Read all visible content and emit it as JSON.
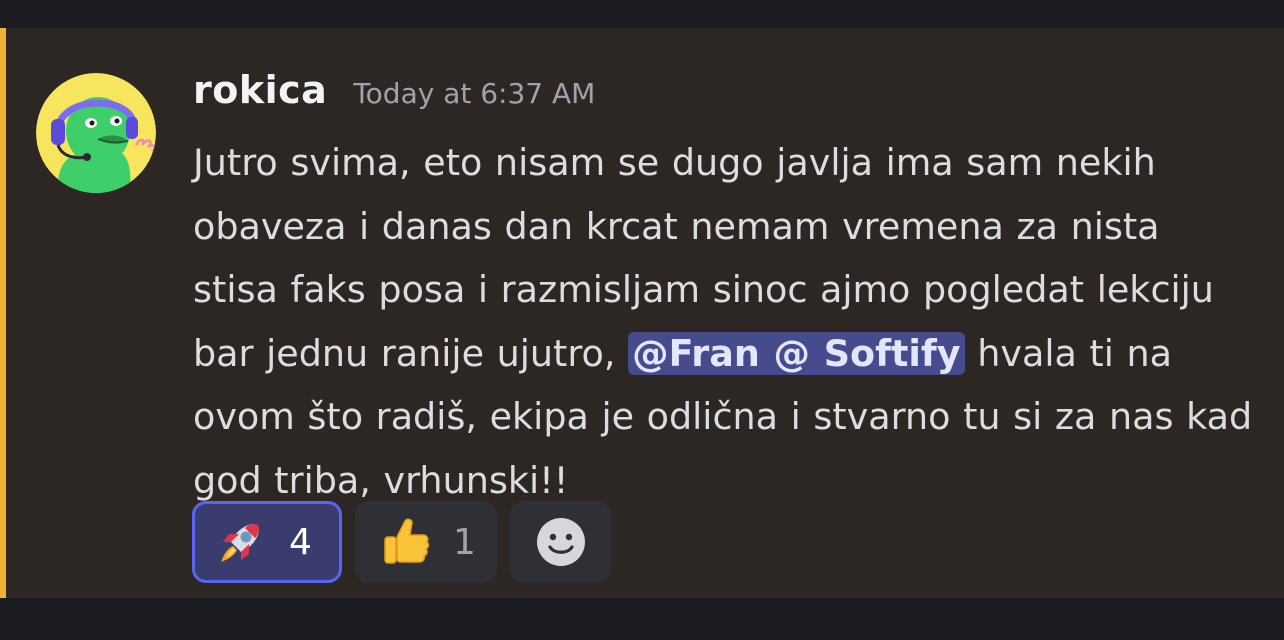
{
  "message": {
    "author": {
      "username": "rokica",
      "avatar_icon": "green-bird-headset-avatar-icon"
    },
    "timestamp": "Today at 6:37 AM",
    "content": {
      "text_before": "Jutro svima, eto nisam se dugo javlja ima sam nekih obaveza i danas dan krcat nemam vremena za nista stisa faks posa i razmisljam sinoc ajmo pogledat lekciju bar jednu ranije ujutro, ",
      "mention": "@Fran @ Softify",
      "text_after": " hvala ti na ovom što radiš, ekipa je odlična i stvarno tu si za nas kad god triba, vrhunski!!"
    },
    "reactions": [
      {
        "emoji": "rocket-icon",
        "count": "4",
        "active": true
      },
      {
        "emoji": "thumbs-up-icon",
        "count": "1",
        "active": false
      }
    ],
    "add_reaction_icon": "smiley-face-icon"
  },
  "colors": {
    "accent_bar": "#f0b232",
    "mention_bg": "#454b8c",
    "active_reaction_border": "#5865f2"
  }
}
